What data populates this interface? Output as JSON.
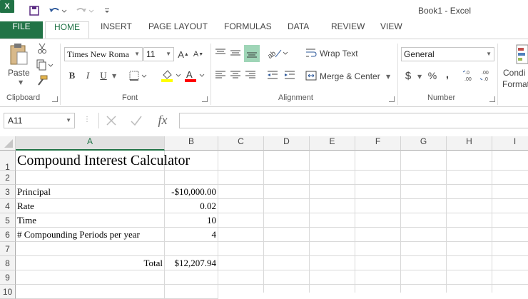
{
  "window": {
    "title": "Book1 - Excel",
    "app_badge": "X"
  },
  "tabs": [
    "FILE",
    "HOME",
    "INSERT",
    "PAGE LAYOUT",
    "FORMULAS",
    "DATA",
    "REVIEW",
    "VIEW"
  ],
  "ribbon": {
    "clipboard": {
      "label": "Clipboard",
      "paste": "Paste"
    },
    "font": {
      "label": "Font",
      "name": "Times New Roma",
      "size": "11",
      "bold": "B",
      "italic": "I",
      "underline": "U"
    },
    "alignment": {
      "label": "Alignment",
      "wrap_text": "Wrap Text",
      "merge_center": "Merge & Center"
    },
    "number": {
      "label": "Number",
      "format": "General",
      "currency": "$",
      "percent": "%",
      "comma": ","
    },
    "styles": {
      "cond_line1": "Condi",
      "cond_line2": "Format"
    }
  },
  "formula_bar": {
    "name_box": "A11",
    "fx": "fx",
    "value": ""
  },
  "sheet": {
    "columns": [
      "A",
      "B",
      "C",
      "D",
      "E",
      "F",
      "G",
      "H",
      "I"
    ],
    "rows": [
      "1",
      "2",
      "3",
      "4",
      "5",
      "6",
      "7",
      "8",
      "9",
      "10"
    ],
    "cells": {
      "A1": "Compound Interest Calculator",
      "A3": "Principal",
      "B3": "-$10,000.00",
      "A4": "Rate",
      "B4": "0.02",
      "A5": "Time",
      "B5": "10",
      "A6": "# Compounding Periods per year",
      "B6": "4",
      "A8": "Total",
      "B8": "$12,207.94"
    }
  },
  "colors": {
    "accent": "#217346",
    "header_bg": "#f3f3f3",
    "grid_line": "#d9d9d9",
    "font_highlight": "#ffff00",
    "font_color": "#ff0000"
  }
}
